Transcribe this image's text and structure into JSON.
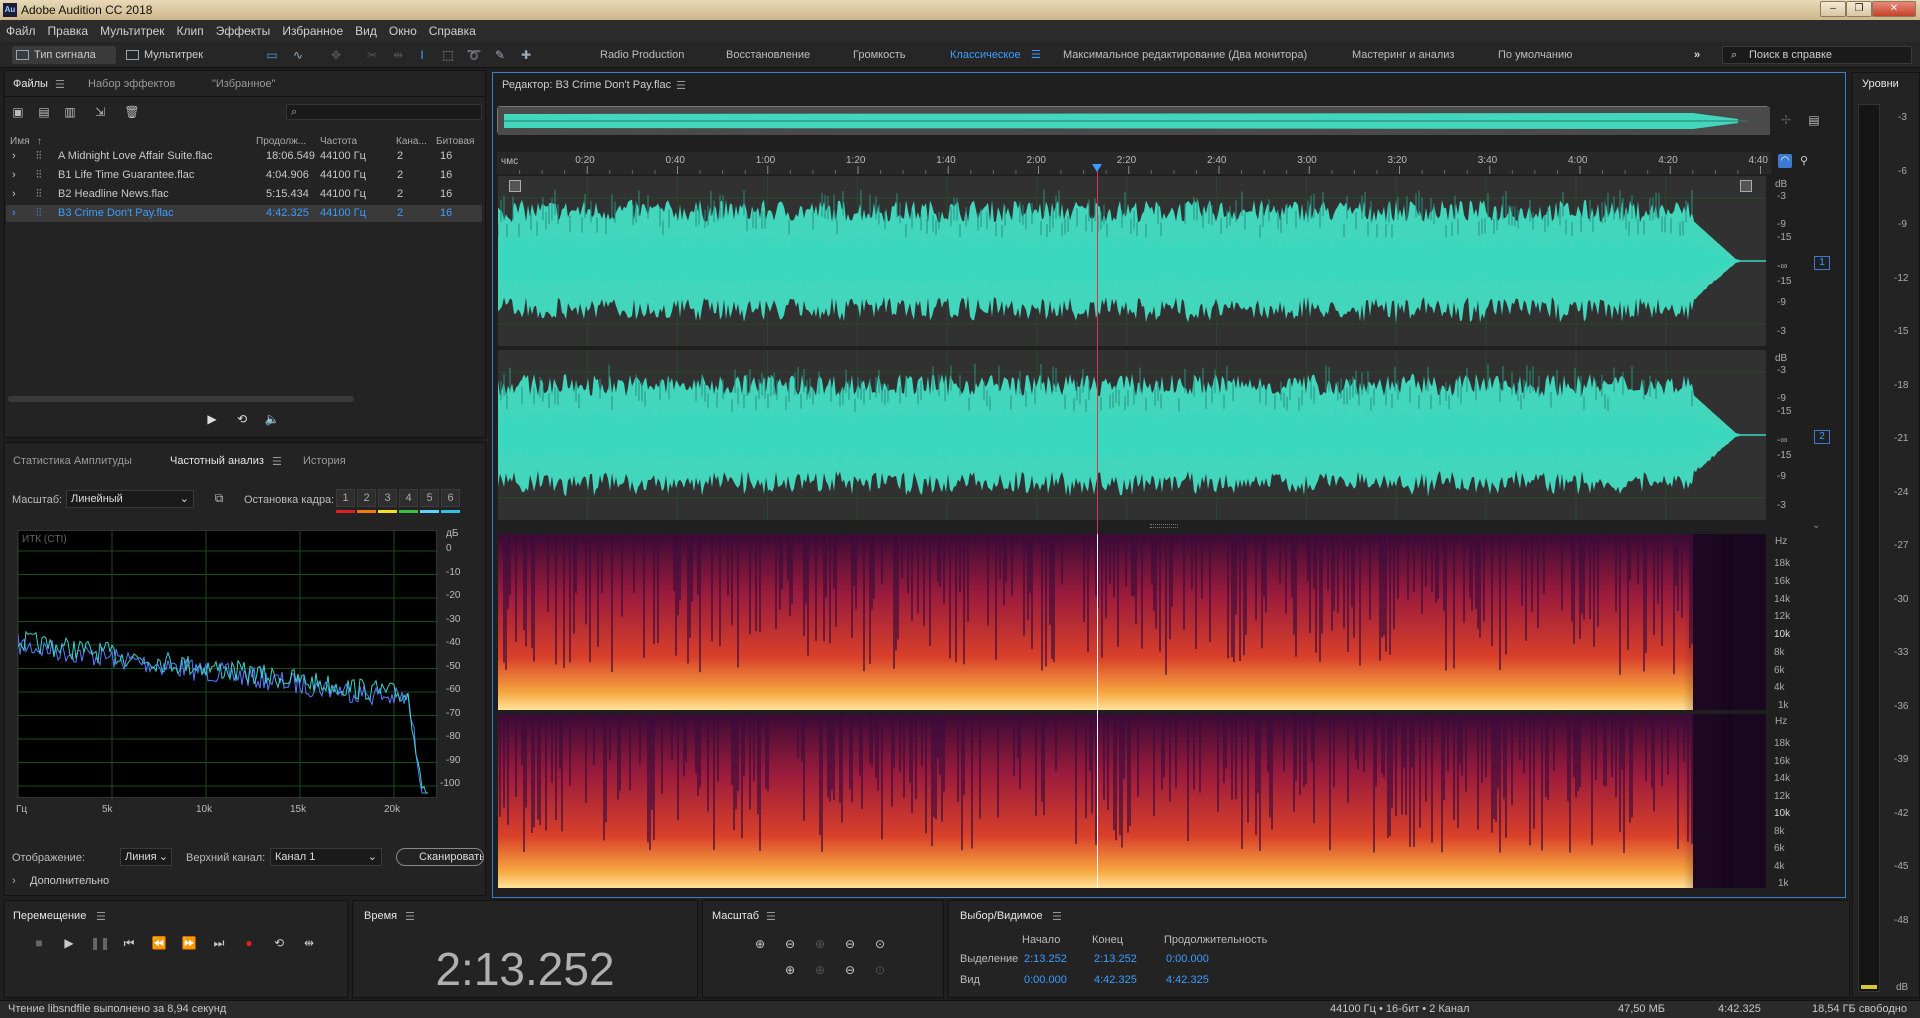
{
  "window": {
    "title": "Adobe Audition CC 2018",
    "app_badge": "Au"
  },
  "menu": [
    "Файл",
    "Правка",
    "Мультитрек",
    "Клип",
    "Эффекты",
    "Избранное",
    "Вид",
    "Окно",
    "Справка"
  ],
  "toolbar": {
    "mode_waveform": "Тип сигнала",
    "mode_multitrack": "Мультитрек",
    "workspaces": [
      "Radio Production",
      "Восстановление",
      "Громкость",
      "Классическое",
      "Максимальное редактирование (Два монитора)",
      "Мастеринг и анализ",
      "По умолчанию"
    ],
    "active_workspace": "Классическое",
    "search_placeholder": "Поиск в справке"
  },
  "files_panel": {
    "tabs": [
      "Файлы",
      "Набор эффектов",
      "\"Избранное\""
    ],
    "columns": [
      "Имя",
      "Продолж...",
      "Частота",
      "Кана...",
      "Битовая"
    ],
    "rows": [
      {
        "name": "A Midnight Love Affair Suite.flac",
        "duration": "18:06.549",
        "rate": "44100 Гц",
        "channels": "2",
        "bits": "16"
      },
      {
        "name": "B1 Life Time Guarantee.flac",
        "duration": "4:04.906",
        "rate": "44100 Гц",
        "channels": "2",
        "bits": "16"
      },
      {
        "name": "B2 Headline News.flac",
        "duration": "5:15.434",
        "rate": "44100 Гц",
        "channels": "2",
        "bits": "16"
      },
      {
        "name": "B3 Crime Don't Pay.flac",
        "duration": "4:42.325",
        "rate": "44100 Гц",
        "channels": "2",
        "bits": "16"
      }
    ],
    "selected_row": 3
  },
  "analysis_panel": {
    "tabs": [
      "Статистика Амплитуды",
      "Частотный анализ",
      "История"
    ],
    "scale_label": "Масштаб:",
    "scale_value": "Линейный",
    "freeze_label": "Остановка кадра:",
    "freeze_buttons": [
      "1",
      "2",
      "3",
      "4",
      "5",
      "6"
    ],
    "freeze_colors": [
      "#e02020",
      "#f07a10",
      "#f0e020",
      "#40c040",
      "#60d0ff",
      "#30c0e0"
    ],
    "graph_label": "ИТК (CTI)",
    "db_unit": "дБ",
    "db_ticks": [
      "0",
      "-10",
      "-20",
      "-30",
      "-40",
      "-50",
      "-60",
      "-70",
      "-80",
      "-90",
      "-100"
    ],
    "x_ticks": [
      "Гц",
      "5k",
      "10k",
      "15k",
      "20k"
    ],
    "display_label": "Отображение:",
    "display_value": "Линия",
    "top_channel_label": "Верхний канал:",
    "top_channel_value": "Канал 1",
    "scan_button": "Сканировать",
    "advanced": "Дополнительно"
  },
  "editor": {
    "title": "Редактор: B3 Crime Don't Pay.flac",
    "ruler_unit": "чмс",
    "ruler_ticks": [
      "0:20",
      "0:40",
      "1:00",
      "1:20",
      "1:40",
      "2:00",
      "2:20",
      "2:40",
      "3:00",
      "3:20",
      "3:40",
      "4:00",
      "4:20",
      "4:40"
    ],
    "db_unit": "dB",
    "db_ticks": [
      "-3",
      "-9",
      "-15",
      "-∞",
      "-15",
      "-9",
      "-3"
    ],
    "channel_badges": [
      "1",
      "2"
    ],
    "hz_unit": "Hz",
    "hz_ticks": [
      "18k",
      "16k",
      "14k",
      "12k",
      "10k",
      "8k",
      "6k",
      "4k",
      "1k"
    ],
    "playhead_fraction": 0.4727
  },
  "levels": {
    "title": "Уровни",
    "ticks": [
      "-3",
      "-6",
      "-9",
      "-12",
      "-15",
      "-18",
      "-21",
      "-24",
      "-27",
      "-30",
      "-33",
      "-36",
      "-39",
      "-42",
      "-45",
      "-48"
    ],
    "unit": "dB"
  },
  "transport": {
    "title": "Перемещение"
  },
  "time": {
    "title": "Время",
    "value": "2:13.252"
  },
  "zoom": {
    "title": "Масштаб"
  },
  "selection": {
    "title": "Выбор/Видимое",
    "headers": [
      "Начало",
      "Конец",
      "Продолжительность"
    ],
    "rows": [
      {
        "label": "Выделение",
        "start": "2:13.252",
        "end": "2:13.252",
        "duration": "0:00.000"
      },
      {
        "label": "Вид",
        "start": "0:00.000",
        "end": "4:42.325",
        "duration": "4:42.325"
      }
    ]
  },
  "status": {
    "left": "Чтение libsndfile выполнено за 8,94 секунд",
    "format": "44100 Гц • 16-бит • 2 Канал",
    "size": "47,50 МБ",
    "duration": "4:42.325",
    "free": "18,54 ГБ свободно"
  }
}
